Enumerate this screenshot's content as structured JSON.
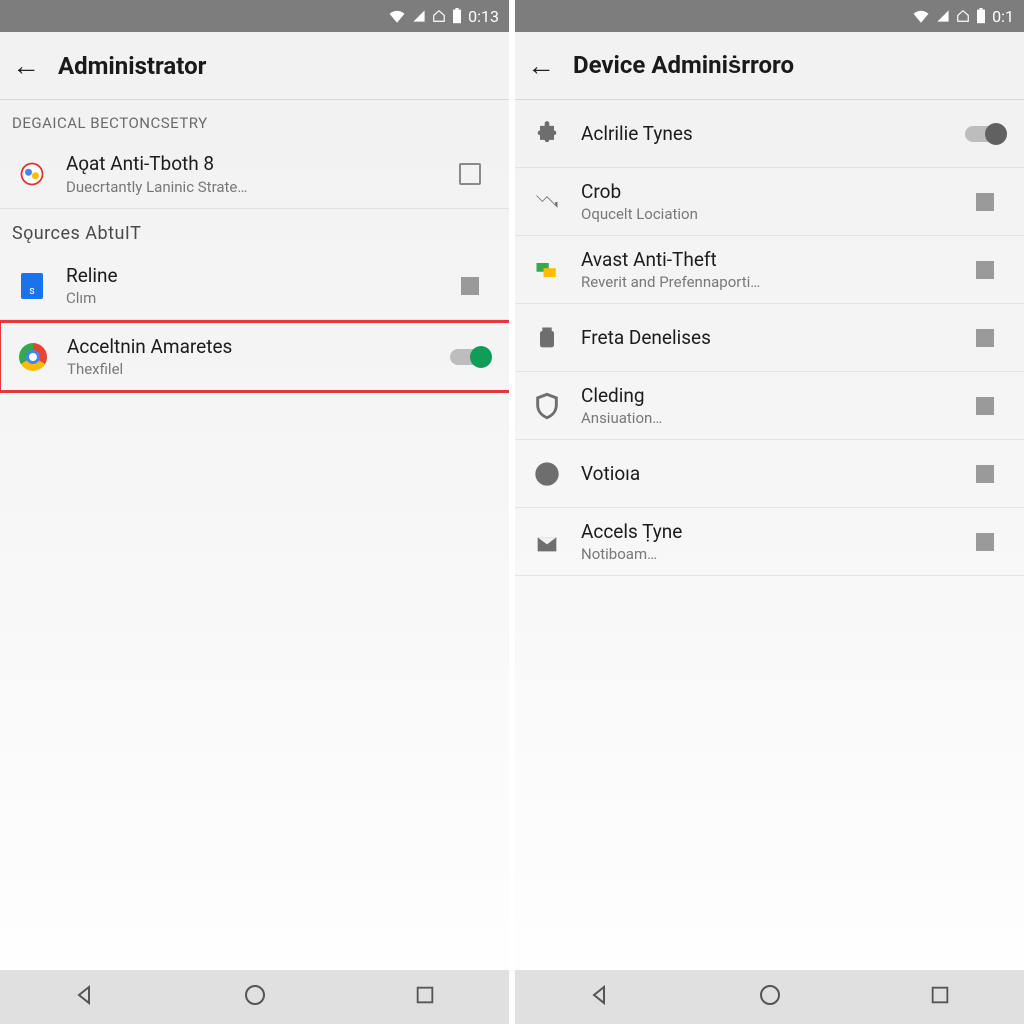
{
  "statusbar": {
    "time": "0:13",
    "time_right": "0:1"
  },
  "left": {
    "title": "Administrator",
    "section1_label": "DEGAICAL BECTONCSETRY",
    "items1": [
      {
        "title": "Aǫat Anti-Tbοth 8",
        "subtitle": "Duecrtantly Laninic Strate…"
      }
    ],
    "section2_label": "Sǫurces AbtuIT",
    "items2": [
      {
        "title": "Reline",
        "subtitle": "Clım"
      },
      {
        "title": "Acceltnin Amaretes",
        "subtitle": "Thexfilel"
      }
    ]
  },
  "right": {
    "title": "Device Adminiṡrroro",
    "items": [
      {
        "title": "Aclrilie Tynes",
        "subtitle": ""
      },
      {
        "title": "Crob",
        "subtitle": "Oqucelt Lociation"
      },
      {
        "title": "Avast Anti-Theft",
        "subtitle": "Reverit and Prefennaporti…"
      },
      {
        "title": "Freta Denelises",
        "subtitle": ""
      },
      {
        "title": "Cleding",
        "subtitle": "Ansiuation…"
      },
      {
        "title": "Votioıa",
        "subtitle": ""
      },
      {
        "title": "Accels Ṭyne",
        "subtitle": "Notiboam…"
      }
    ]
  }
}
